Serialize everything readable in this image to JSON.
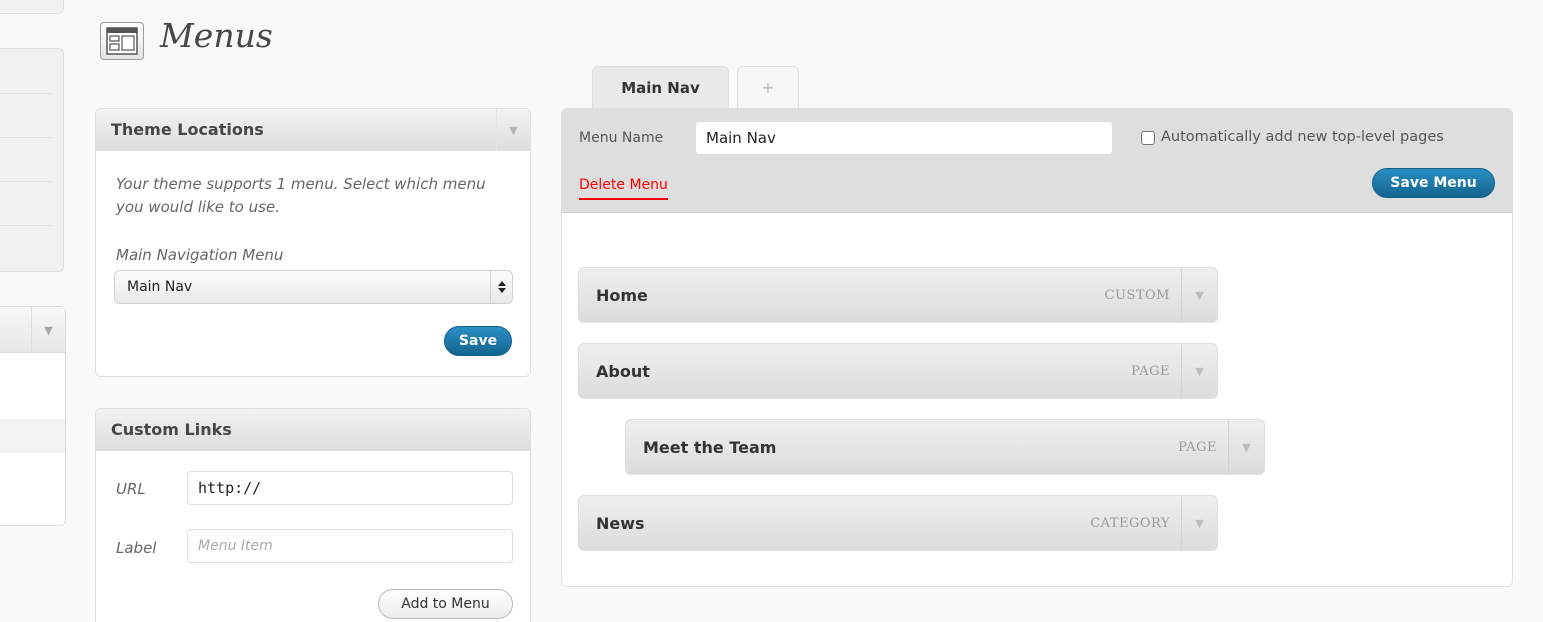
{
  "page": {
    "title": "Menus"
  },
  "theme_locations": {
    "heading": "Theme Locations",
    "description": "Your theme supports 1 menu. Select which menu you would like to use.",
    "location_label": "Main Navigation Menu",
    "selected_menu": "Main Nav",
    "save_label": "Save"
  },
  "custom_links": {
    "heading": "Custom Links",
    "url_label": "URL",
    "url_value": "http://",
    "label_label": "Label",
    "label_placeholder": "Menu Item",
    "add_label": "Add to Menu"
  },
  "menu_tabs": [
    {
      "label": "Main Nav",
      "active": true
    },
    {
      "label": "+",
      "active": false
    }
  ],
  "menu_editor": {
    "name_label": "Menu Name",
    "name_value": "Main Nav",
    "auto_add_label": "Automatically add new top-level pages",
    "auto_add_checked": false,
    "delete_label": "Delete Menu",
    "save_label": "Save Menu"
  },
  "menu_items": [
    {
      "title": "Home",
      "type": "CUSTOM",
      "depth": 0
    },
    {
      "title": "About",
      "type": "PAGE",
      "depth": 0
    },
    {
      "title": "Meet the Team",
      "type": "PAGE",
      "depth": 1
    },
    {
      "title": "News",
      "type": "CATEGORY",
      "depth": 0
    }
  ],
  "icons": {
    "page_icon": "menus-page-icon",
    "toggle": "triangle-down-icon",
    "select": "select-arrows-icon"
  },
  "colors": {
    "accent": "#21759b",
    "delete": "#ff0000",
    "panel_bg": "#dedede"
  }
}
